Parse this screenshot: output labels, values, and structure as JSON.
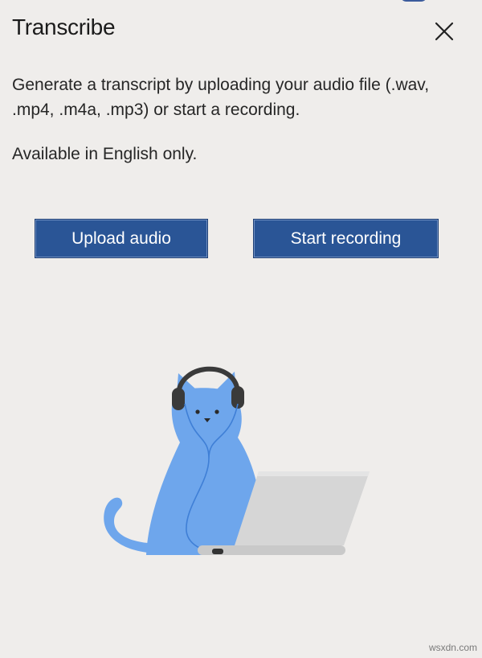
{
  "pane": {
    "title": "Transcribe",
    "description": "Generate a transcript by uploading your audio file (.wav, .mp4, .m4a, .mp3) or start a recording.",
    "note": "Available in English only.",
    "close_icon": "close-icon"
  },
  "actions": {
    "upload_label": "Upload audio",
    "record_label": "Start recording"
  },
  "illustration": {
    "subject": "cat-with-headphones-and-laptop",
    "cat_color": "#6ea6ec",
    "headphone_color": "#3a3a3a",
    "laptop_color": "#d6d6d6"
  },
  "colors": {
    "background": "#efedeb",
    "button": "#2a5596",
    "button_text": "#ffffff"
  },
  "watermark": "wsxdn.com"
}
